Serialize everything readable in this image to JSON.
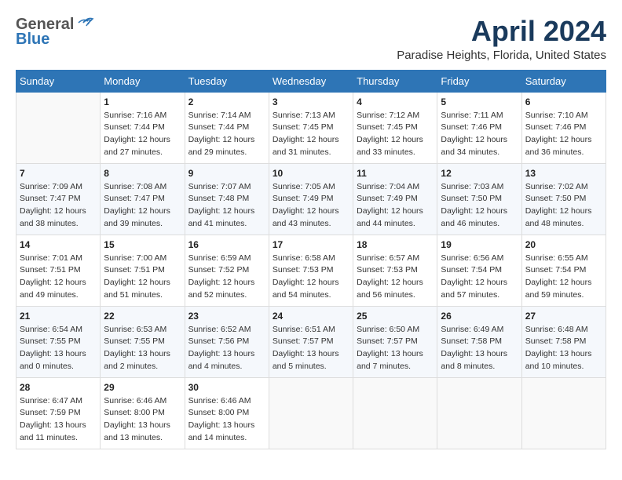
{
  "header": {
    "logo_general": "General",
    "logo_blue": "Blue",
    "month_title": "April 2024",
    "location": "Paradise Heights, Florida, United States"
  },
  "calendar": {
    "days_of_week": [
      "Sunday",
      "Monday",
      "Tuesday",
      "Wednesday",
      "Thursday",
      "Friday",
      "Saturday"
    ],
    "weeks": [
      [
        {
          "day": "",
          "info": ""
        },
        {
          "day": "1",
          "info": "Sunrise: 7:16 AM\nSunset: 7:44 PM\nDaylight: 12 hours\nand 27 minutes."
        },
        {
          "day": "2",
          "info": "Sunrise: 7:14 AM\nSunset: 7:44 PM\nDaylight: 12 hours\nand 29 minutes."
        },
        {
          "day": "3",
          "info": "Sunrise: 7:13 AM\nSunset: 7:45 PM\nDaylight: 12 hours\nand 31 minutes."
        },
        {
          "day": "4",
          "info": "Sunrise: 7:12 AM\nSunset: 7:45 PM\nDaylight: 12 hours\nand 33 minutes."
        },
        {
          "day": "5",
          "info": "Sunrise: 7:11 AM\nSunset: 7:46 PM\nDaylight: 12 hours\nand 34 minutes."
        },
        {
          "day": "6",
          "info": "Sunrise: 7:10 AM\nSunset: 7:46 PM\nDaylight: 12 hours\nand 36 minutes."
        }
      ],
      [
        {
          "day": "7",
          "info": "Sunrise: 7:09 AM\nSunset: 7:47 PM\nDaylight: 12 hours\nand 38 minutes."
        },
        {
          "day": "8",
          "info": "Sunrise: 7:08 AM\nSunset: 7:47 PM\nDaylight: 12 hours\nand 39 minutes."
        },
        {
          "day": "9",
          "info": "Sunrise: 7:07 AM\nSunset: 7:48 PM\nDaylight: 12 hours\nand 41 minutes."
        },
        {
          "day": "10",
          "info": "Sunrise: 7:05 AM\nSunset: 7:49 PM\nDaylight: 12 hours\nand 43 minutes."
        },
        {
          "day": "11",
          "info": "Sunrise: 7:04 AM\nSunset: 7:49 PM\nDaylight: 12 hours\nand 44 minutes."
        },
        {
          "day": "12",
          "info": "Sunrise: 7:03 AM\nSunset: 7:50 PM\nDaylight: 12 hours\nand 46 minutes."
        },
        {
          "day": "13",
          "info": "Sunrise: 7:02 AM\nSunset: 7:50 PM\nDaylight: 12 hours\nand 48 minutes."
        }
      ],
      [
        {
          "day": "14",
          "info": "Sunrise: 7:01 AM\nSunset: 7:51 PM\nDaylight: 12 hours\nand 49 minutes."
        },
        {
          "day": "15",
          "info": "Sunrise: 7:00 AM\nSunset: 7:51 PM\nDaylight: 12 hours\nand 51 minutes."
        },
        {
          "day": "16",
          "info": "Sunrise: 6:59 AM\nSunset: 7:52 PM\nDaylight: 12 hours\nand 52 minutes."
        },
        {
          "day": "17",
          "info": "Sunrise: 6:58 AM\nSunset: 7:53 PM\nDaylight: 12 hours\nand 54 minutes."
        },
        {
          "day": "18",
          "info": "Sunrise: 6:57 AM\nSunset: 7:53 PM\nDaylight: 12 hours\nand 56 minutes."
        },
        {
          "day": "19",
          "info": "Sunrise: 6:56 AM\nSunset: 7:54 PM\nDaylight: 12 hours\nand 57 minutes."
        },
        {
          "day": "20",
          "info": "Sunrise: 6:55 AM\nSunset: 7:54 PM\nDaylight: 12 hours\nand 59 minutes."
        }
      ],
      [
        {
          "day": "21",
          "info": "Sunrise: 6:54 AM\nSunset: 7:55 PM\nDaylight: 13 hours\nand 0 minutes."
        },
        {
          "day": "22",
          "info": "Sunrise: 6:53 AM\nSunset: 7:55 PM\nDaylight: 13 hours\nand 2 minutes."
        },
        {
          "day": "23",
          "info": "Sunrise: 6:52 AM\nSunset: 7:56 PM\nDaylight: 13 hours\nand 4 minutes."
        },
        {
          "day": "24",
          "info": "Sunrise: 6:51 AM\nSunset: 7:57 PM\nDaylight: 13 hours\nand 5 minutes."
        },
        {
          "day": "25",
          "info": "Sunrise: 6:50 AM\nSunset: 7:57 PM\nDaylight: 13 hours\nand 7 minutes."
        },
        {
          "day": "26",
          "info": "Sunrise: 6:49 AM\nSunset: 7:58 PM\nDaylight: 13 hours\nand 8 minutes."
        },
        {
          "day": "27",
          "info": "Sunrise: 6:48 AM\nSunset: 7:58 PM\nDaylight: 13 hours\nand 10 minutes."
        }
      ],
      [
        {
          "day": "28",
          "info": "Sunrise: 6:47 AM\nSunset: 7:59 PM\nDaylight: 13 hours\nand 11 minutes."
        },
        {
          "day": "29",
          "info": "Sunrise: 6:46 AM\nSunset: 8:00 PM\nDaylight: 13 hours\nand 13 minutes."
        },
        {
          "day": "30",
          "info": "Sunrise: 6:46 AM\nSunset: 8:00 PM\nDaylight: 13 hours\nand 14 minutes."
        },
        {
          "day": "",
          "info": ""
        },
        {
          "day": "",
          "info": ""
        },
        {
          "day": "",
          "info": ""
        },
        {
          "day": "",
          "info": ""
        }
      ]
    ]
  }
}
